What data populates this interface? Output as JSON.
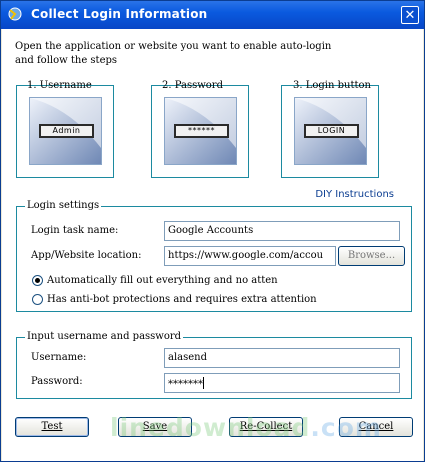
{
  "window": {
    "title": "Collect Login Information",
    "close_symbol": "✕"
  },
  "intro_text": "Open the application or website you want to enable auto-login\nand follow the steps",
  "steps": [
    {
      "label": "1. Username",
      "field_text": "Admin"
    },
    {
      "label": "2. Password",
      "field_text": "******"
    },
    {
      "label": "3. Login button",
      "field_text": "LOGIN"
    }
  ],
  "diy_link": "DIY Instructions",
  "login_settings": {
    "title": "Login settings",
    "task_name_label": "Login task name:",
    "task_name_value": "Google Accounts",
    "location_label": "App/Website location:",
    "location_value": "https://www.google.com/accou",
    "browse_label": "Browse...",
    "radio_auto_label": "Automatically fill out everything and no atten",
    "radio_antibot_label": "Has anti-bot protections and requires extra attention",
    "selected_option": "auto"
  },
  "credentials": {
    "title": "Input username and password",
    "username_label": "Username:",
    "username_value": "alasend",
    "password_label": "Password:",
    "password_value": "*******"
  },
  "buttons": {
    "test": "Test",
    "save": "Save",
    "recollect": "Re-Collect",
    "cancel": "Cancel"
  },
  "watermark": {
    "text_main": "linedownload",
    "text_accent": ".com"
  },
  "colors": {
    "titlebar": "#0a5adf",
    "group_border": "#1c8aa0",
    "link": "#0b3d91"
  }
}
